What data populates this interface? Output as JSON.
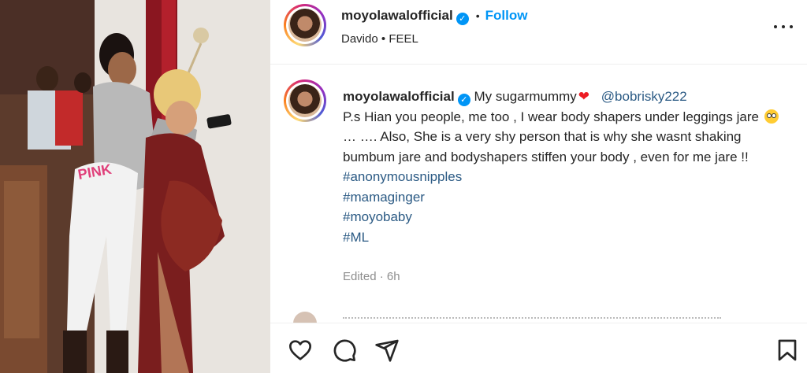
{
  "post": {
    "username": "moyolawalofficial",
    "verified_icon": "verified-badge-icon",
    "follow_label": "Follow",
    "music_artist": "Davido",
    "music_separator": "•",
    "music_title": "FEEL"
  },
  "caption": {
    "username": "moyolawalofficial",
    "intro": "My sugarmummy",
    "heart": "❤",
    "mention": "@bobrisky222",
    "body_1": "P.s Hian you people, me too , I wear body shapers under leggings jare",
    "body_2": "… …. Also, She is a very shy person that is why she wasnt shaking bumbum jare and bodyshapers stiffen your body , even for me jare !!",
    "hashtags": [
      "#anonymousnipples",
      "#mamaginger",
      "#moyobaby",
      "#ML"
    ],
    "edited": "Edited · 6h"
  },
  "actions": {
    "icons": [
      "heart-icon",
      "comment-icon",
      "share-icon",
      "bookmark-icon"
    ]
  },
  "colors": {
    "link": "#2b5a84",
    "follow": "#0095f6",
    "verified": "#0095f6",
    "muted": "#8e8e8e"
  }
}
